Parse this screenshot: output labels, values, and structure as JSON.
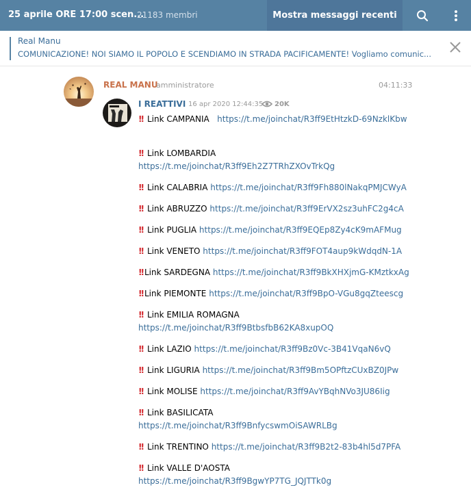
{
  "header": {
    "title": "25 aprile ORE 17:00 scen...",
    "members": "21183 membri",
    "recent_button": "Mostra messaggi recenti",
    "search_icon": "search-icon",
    "more_icon": "more-vertical-icon",
    "background": "#5682a3"
  },
  "pinned": {
    "title": "Real Manu",
    "text": "COMUNICAZIONE! NOI SIAMO IL POPOLO E SCENDIAMO IN STRADA PACIFICAMENTE! Vogliamo comunic...",
    "close_icon": "close-icon"
  },
  "message": {
    "author": "REAL MANU",
    "role": "amministratore",
    "time": "04:11:33",
    "avatar_icon": "sunset-silhouette-avatar",
    "forwarded": {
      "author": "I REATTIVI",
      "date": "16 apr 2020 12:44:35",
      "views": "20K",
      "views_icon": "eye-icon",
      "avatar_icon": "reattivi-avatar"
    },
    "regions": [
      {
        "label": "Link CAMPANIA",
        "link": "https://t.me/joinchat/R3ff9EtHtzkD-69NzklKbw"
      },
      {
        "label": "Link LOMBARDIA",
        "link": "https://t.me/joinchat/R3ff9Eh2Z7TRhZXOvTrkQg"
      },
      {
        "label": "Link CALABRIA",
        "link": "https://t.me/joinchat/R3ff9Fh880lNakqPMJCWyA"
      },
      {
        "label": "Link ABRUZZO",
        "link": "https://t.me/joinchat/R3ff9ErVX2sz3uhFC2g4cA"
      },
      {
        "label": "Link PUGLIA",
        "link": "https://t.me/joinchat/R3ff9EQEp8Zy4cK9mAFMug"
      },
      {
        "label": "Link VENETO",
        "link": "https://t.me/joinchat/R3ff9FOT4aup9kWdqdN-1A"
      },
      {
        "label": "Link SARDEGNA",
        "link": "https://t.me/joinchat/R3ff9BkXHXjmG-KMztkxAg"
      },
      {
        "label": "Link PIEMONTE",
        "link": "https://t.me/joinchat/R3ff9BpO-VGu8gqZteescg"
      },
      {
        "label": "Link EMILIA ROMAGNA",
        "link": "https://t.me/joinchat/R3ff9BtbsfbB62KA8xupOQ"
      },
      {
        "label": "Link LAZIO",
        "link": "https://t.me/joinchat/R3ff9Bz0Vc-3B41VqaN6vQ"
      },
      {
        "label": "Link LIGURIA",
        "link": "https://t.me/joinchat/R3ff9Bm5OPftzCUxBZ0JPw"
      },
      {
        "label": "Link MOLISE",
        "link": "https://t.me/joinchat/R3ff9AvYBqhNVo3JU86Iig"
      },
      {
        "label": "Link BASILICATA",
        "link": "https://t.me/joinchat/R3ff9BnfycswmOiSAWRLBg"
      },
      {
        "label": "Link TRENTINO",
        "link": "https://t.me/joinchat/R3ff9B2t2-83b4hl5d7PFA"
      },
      {
        "label": "Link VALLE D'AOSTA",
        "link": "https://t.me/joinchat/R3ff9BgwYP7TG_JQJTTk0g"
      }
    ],
    "bullet": "!!"
  }
}
